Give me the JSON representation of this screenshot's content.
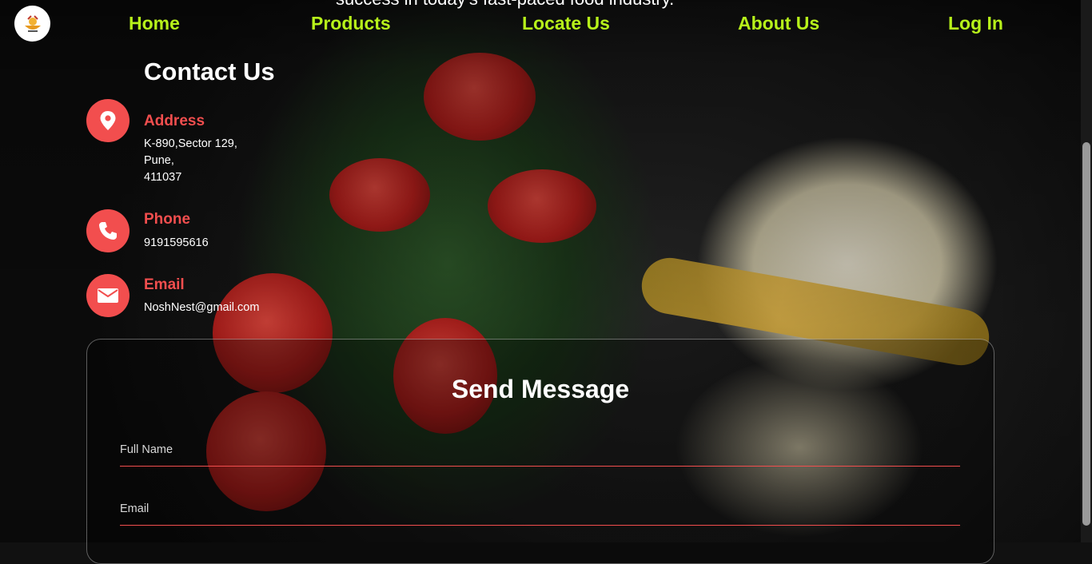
{
  "hero": {
    "tagline": "success in today's fast-paced food industry."
  },
  "nav": {
    "logo_alt": "NoshNest logo",
    "items": [
      "Home",
      "Products",
      "Locate Us",
      "About Us",
      "Log In"
    ]
  },
  "contact": {
    "title": "Contact Us",
    "address": {
      "label": "Address",
      "lines": [
        "K-890,Sector 129,",
        "Pune,",
        "411037"
      ],
      "icon": "location-pin-icon"
    },
    "phone": {
      "label": "Phone",
      "value": "9191595616",
      "icon": "phone-icon"
    },
    "email": {
      "label": "Email",
      "value": "NoshNest@gmail.com",
      "icon": "envelope-icon"
    }
  },
  "form": {
    "title": "Send Message",
    "full_name_placeholder": "Full Name",
    "email_placeholder": "Email"
  },
  "colors": {
    "nav_accent": "#b7f21a",
    "contact_accent": "#f24e4e"
  }
}
